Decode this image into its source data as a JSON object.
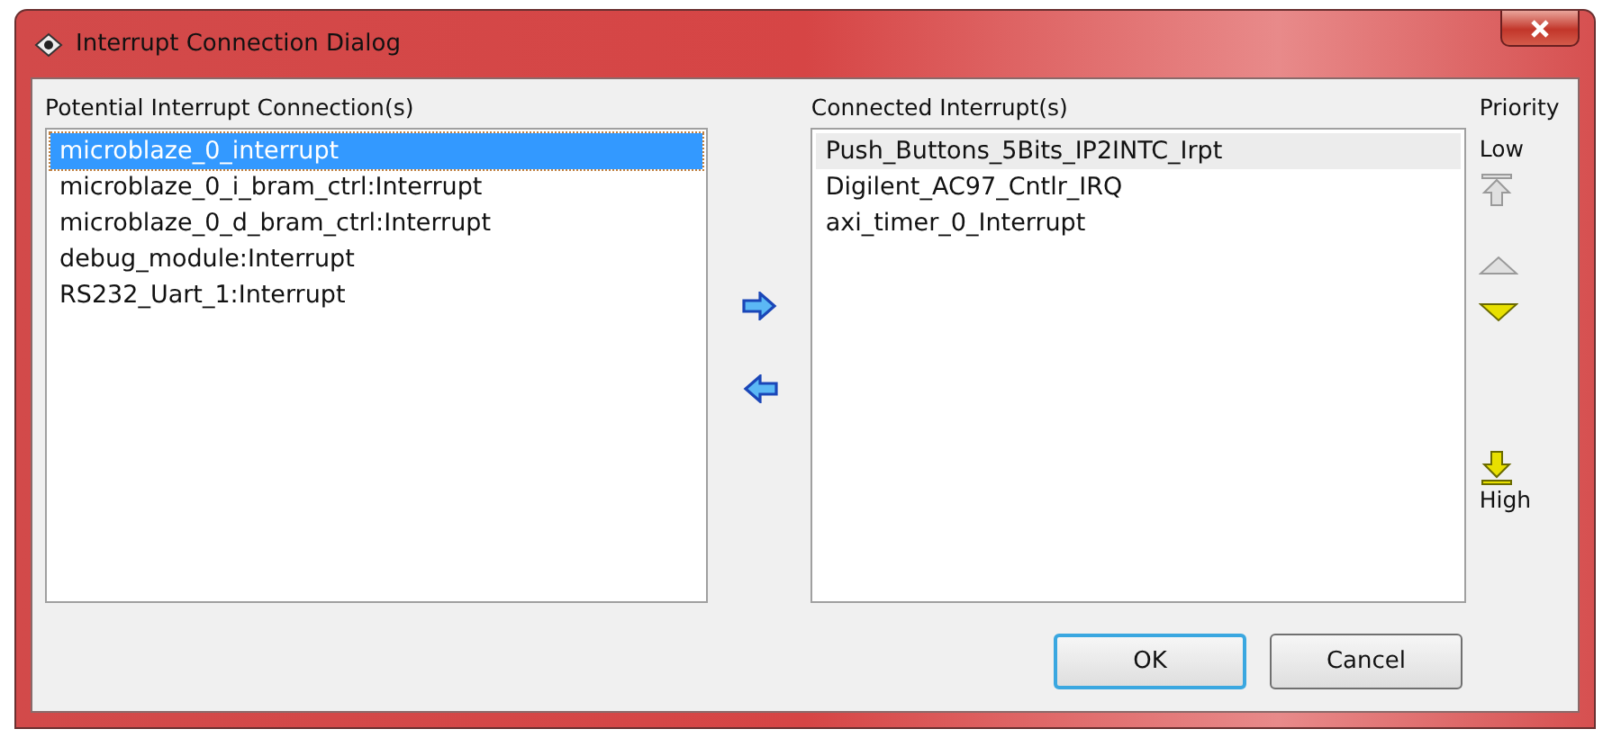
{
  "window": {
    "title": "Interrupt Connection Dialog"
  },
  "potential": {
    "label": "Potential Interrupt Connection(s)",
    "items": [
      {
        "text": "microblaze_0_interrupt",
        "selected": true
      },
      {
        "text": "microblaze_0_i_bram_ctrl:Interrupt",
        "selected": false
      },
      {
        "text": "microblaze_0_d_bram_ctrl:Interrupt",
        "selected": false
      },
      {
        "text": "debug_module:Interrupt",
        "selected": false
      },
      {
        "text": "RS232_Uart_1:Interrupt",
        "selected": false
      }
    ]
  },
  "transfer": [
    {
      "kind": "add"
    },
    {
      "kind": "remove"
    }
  ],
  "connected": {
    "label": "Connected Interrupt(s)",
    "items": [
      {
        "text": "Push_Buttons_5Bits_IP2INTC_Irpt",
        "selected": true
      },
      {
        "text": "Digilent_AC97_Cntlr_IRQ",
        "selected": false
      },
      {
        "text": "axi_timer_0_Interrupt",
        "selected": false
      }
    ]
  },
  "priority": {
    "label": "Priority",
    "low": "Low",
    "high": "High",
    "buttons": [
      {
        "kind": "top",
        "disabled": true
      },
      {
        "kind": "up",
        "disabled": true
      },
      {
        "kind": "down",
        "disabled": false
      },
      {
        "kind": "bottom",
        "disabled": false
      }
    ]
  },
  "buttons": [
    {
      "label": "OK",
      "default": true
    },
    {
      "label": "Cancel",
      "default": false
    }
  ]
}
